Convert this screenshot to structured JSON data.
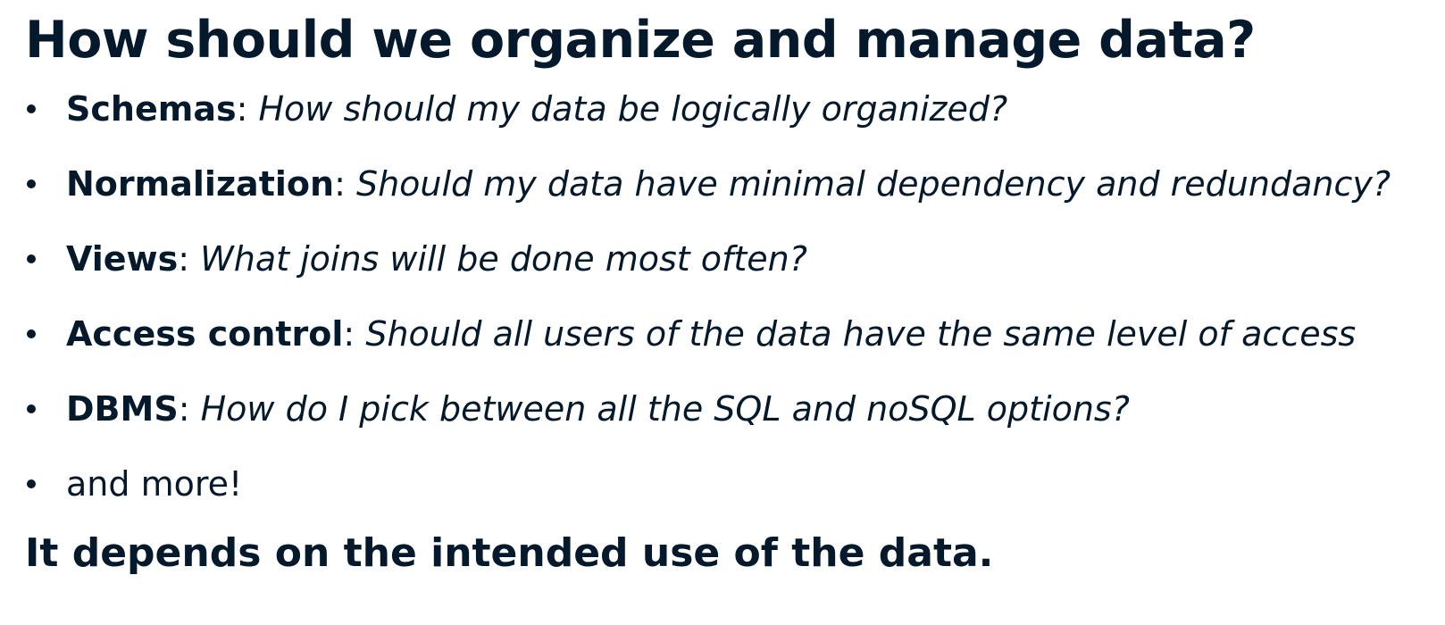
{
  "title": "How should we organize and manage data?",
  "bullets": [
    {
      "term": "Schemas",
      "separator": ": ",
      "question": "How should my data be logically organized?"
    },
    {
      "term": "Normalization",
      "separator": ": ",
      "question": "Should my data have minimal dependency and redundancy?"
    },
    {
      "term": "Views",
      "separator": ": ",
      "question": "What joins will be done most often?"
    },
    {
      "term": "Access control",
      "separator": ": ",
      "question": "Should all users of the data have the same level of access"
    },
    {
      "term": "DBMS",
      "separator": ": ",
      "question": "How do I pick between all the SQL and noSQL options?"
    },
    {
      "text": "and more!"
    }
  ],
  "conclusion": "It depends on the intended use of the data.",
  "colors": {
    "text": "#05192d",
    "background": "#ffffff"
  }
}
